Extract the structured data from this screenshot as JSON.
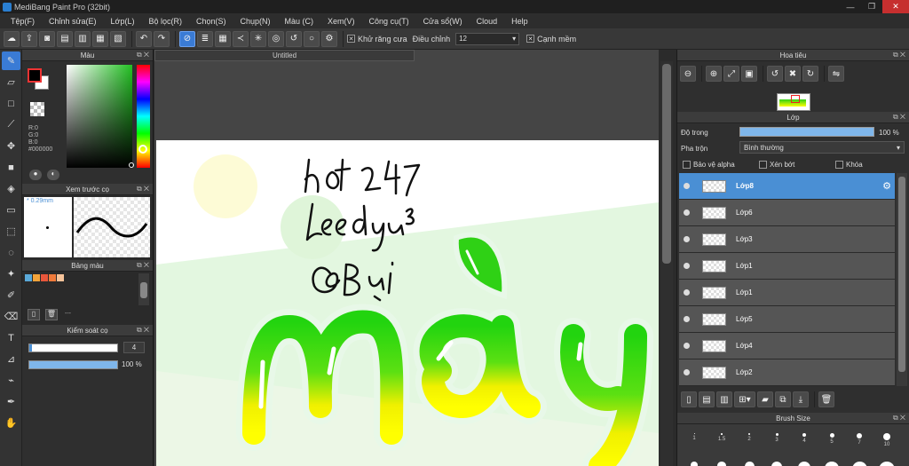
{
  "window": {
    "title": "MediBang Paint Pro (32bit)",
    "min": "—",
    "max": "❐",
    "close": "✕"
  },
  "menu": [
    "Tệp(F)",
    "Chỉnh sửa(E)",
    "Lớp(L)",
    "Bộ lọc(R)",
    "Chọn(S)",
    "Chụp(N)",
    "Màu (C)",
    "Xem(V)",
    "Công cụ(T)",
    "Cửa sổ(W)",
    "Cloud",
    "Help"
  ],
  "toolbar": {
    "antialias_label": "Khử răng cưa",
    "adjust_label": "Điều chỉnh",
    "adjust_value": "12",
    "soft_edge_label": "Cạnh mềm"
  },
  "panels": {
    "color": {
      "title": "Màu",
      "r": "R:0",
      "g": "G:0",
      "b": "B:0",
      "hex": "#000000"
    },
    "brush_preview": {
      "title": "Xem trước cọ",
      "size": "0.29mm"
    },
    "palette": {
      "title": "Bảng màu",
      "swatches": [
        "#5aa9d8",
        "#f2a33a",
        "#e8563b",
        "#f07a3a",
        "#f5c39a"
      ],
      "dash": "---"
    },
    "brush_control": {
      "title": "Kiểm soát cọ",
      "size_value": "4",
      "opacity_value": "100 %",
      "size_fraction": 0.03,
      "opacity_fraction": 1.0
    },
    "navigator": {
      "title": "Hoa tiêu"
    },
    "layers": {
      "title": "Lớp",
      "opacity_label": "Độ trong",
      "opacity_value": "100 %",
      "blend_label": "Pha trộn",
      "blend_value": "Bình thường",
      "protect_alpha": "Bảo vệ alpha",
      "clipping": "Xén bớt",
      "lock": "Khóa",
      "items": [
        {
          "name": "Lớp8",
          "selected": true
        },
        {
          "name": "Lớp6",
          "selected": false
        },
        {
          "name": "Lớp3",
          "selected": false
        },
        {
          "name": "Lớp1",
          "selected": false
        },
        {
          "name": "Lớp1",
          "selected": false
        },
        {
          "name": "Lớp5",
          "selected": false
        },
        {
          "name": "Lớp4",
          "selected": false
        },
        {
          "name": "Lớp2",
          "selected": false
        }
      ]
    },
    "brush_size": {
      "title": "Brush Size",
      "labels": [
        "1",
        "1.5",
        "2",
        "3",
        "4",
        "5",
        "7",
        "10"
      ]
    }
  },
  "document": {
    "tab_title": "Untitled"
  }
}
